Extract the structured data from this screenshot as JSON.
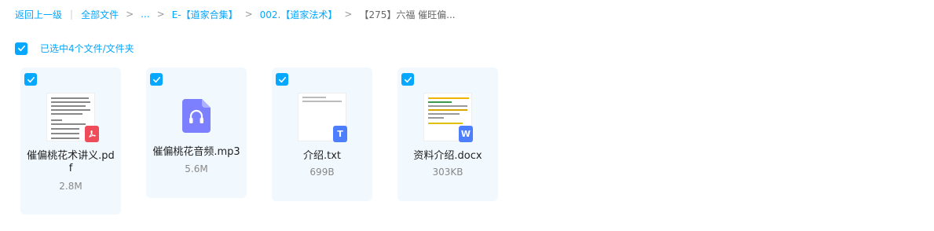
{
  "breadcrumb": {
    "back": "返回上一级",
    "all_files": "全部文件",
    "ellipsis": "...",
    "level1": "E-【道家合集】",
    "level2": "002.【道家法术】",
    "current": "【275】六福 催旺偏..."
  },
  "selection": {
    "text": "已选中4个文件/文件夹"
  },
  "files": [
    {
      "name": "催偏桃花术讲义.pdf",
      "size": "2.8M",
      "type": "pdf"
    },
    {
      "name": "催偏桃花音频.mp3",
      "size": "5.6M",
      "type": "audio"
    },
    {
      "name": "介绍.txt",
      "size": "699B",
      "type": "txt"
    },
    {
      "name": "资料介绍.docx",
      "size": "303KB",
      "type": "docx"
    }
  ],
  "colors": {
    "accent": "#06a7ff",
    "card_bg": "#f1f8fe",
    "pdf_red": "#ee4c5a",
    "audio_purple": "#7c80ff",
    "doc_blue": "#4d7efd"
  }
}
